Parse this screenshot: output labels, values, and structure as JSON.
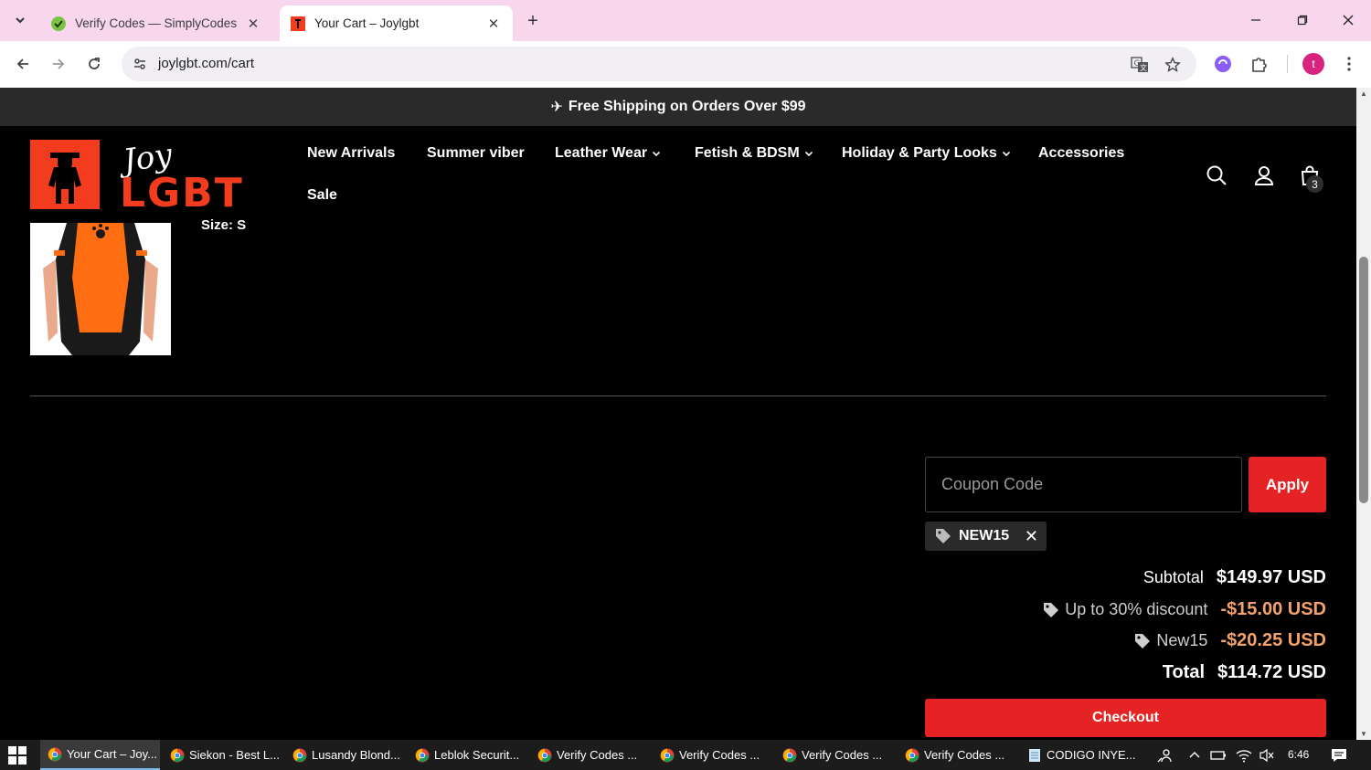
{
  "browser": {
    "tabs": [
      {
        "title": "Verify Codes — SimplyCodes",
        "active": false
      },
      {
        "title": "Your Cart – Joylgbt",
        "active": true
      }
    ],
    "url": "joylgbt.com/cart",
    "profile_initial": "t"
  },
  "site": {
    "announcement": "Free Shipping on Orders Over $99",
    "logo": {
      "script": "Joy",
      "word": "LGBT"
    },
    "nav": [
      {
        "label": "New Arrivals",
        "has_dropdown": false
      },
      {
        "label": "Summer viber",
        "has_dropdown": false
      },
      {
        "label": "Leather Wear",
        "has_dropdown": true
      },
      {
        "label": "Fetish & BDSM",
        "has_dropdown": true
      },
      {
        "label": "Holiday & Party Looks",
        "has_dropdown": true
      },
      {
        "label": "Accessories",
        "has_dropdown": false
      },
      {
        "label": "Sale",
        "has_dropdown": false
      }
    ],
    "cart_count": "3"
  },
  "cart": {
    "item_size_line": "Size: S",
    "coupon_placeholder": "Coupon Code",
    "apply_label": "Apply",
    "applied_code": "NEW15",
    "summary": {
      "subtotal_label": "Subtotal",
      "subtotal_value": "$149.97 USD",
      "discount1_label": "Up to 30% discount",
      "discount1_value": "-$15.00 USD",
      "discount2_label": "New15",
      "discount2_value": "-$20.25 USD",
      "total_label": "Total",
      "total_value": "$114.72 USD"
    },
    "checkout_label": "Checkout"
  },
  "taskbar": {
    "items": [
      {
        "label": "Your Cart – Joy...",
        "active": true
      },
      {
        "label": "Siekon - Best L...",
        "active": false
      },
      {
        "label": "Lusandy Blond...",
        "active": false
      },
      {
        "label": "Leblok Securit...",
        "active": false
      },
      {
        "label": "Verify Codes ...",
        "active": false
      },
      {
        "label": "Verify Codes ...",
        "active": false
      },
      {
        "label": "Verify Codes ...",
        "active": false
      },
      {
        "label": "Verify Codes ...",
        "active": false
      },
      {
        "label": "CODIGO INYE...",
        "active": false
      }
    ],
    "time": "6:46"
  },
  "colors": {
    "accent_red": "#e52324",
    "logo_orange": "#f23c1d",
    "discount_text": "#f4a26b",
    "tabstrip": "#f7d6ee"
  }
}
